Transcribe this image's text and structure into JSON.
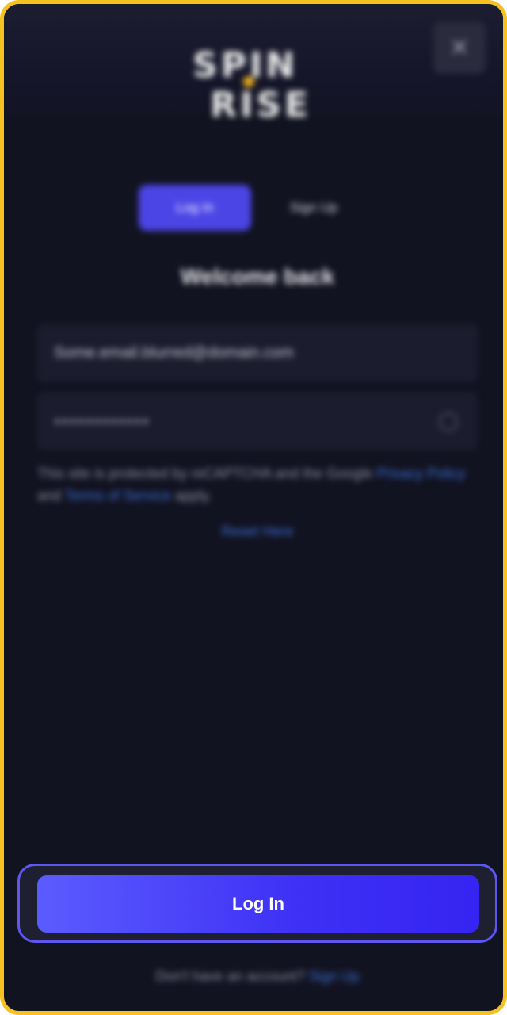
{
  "window": {
    "frame_color": "#f5c21f",
    "background": "#121321"
  },
  "header": {
    "logo_line1": "SPIN",
    "logo_line2": "RISE",
    "close_icon": "close-icon",
    "close_symbol": "✕"
  },
  "tabs": [
    {
      "label": "Log In",
      "active": true
    },
    {
      "label": "Sign Up",
      "active": false
    }
  ],
  "form": {
    "title": "Welcome back",
    "email_value": "Some.email.blurred@domain.com",
    "password_mask": "••••••••••••",
    "eye_icon": "eye-icon",
    "recaptcha_prefix": "This site is protected by reCAPTCHA and the Google",
    "privacy_link": "Privacy Policy",
    "recaptcha_mid": "and",
    "terms_link": "Terms of Service",
    "recaptcha_suffix": "apply.",
    "reset_link": "Reset Here"
  },
  "actions": {
    "login_label": "Log In",
    "accent": "#4b45e6"
  },
  "footer": {
    "prompt": "Don't have an account?",
    "link": "Sign Up"
  }
}
